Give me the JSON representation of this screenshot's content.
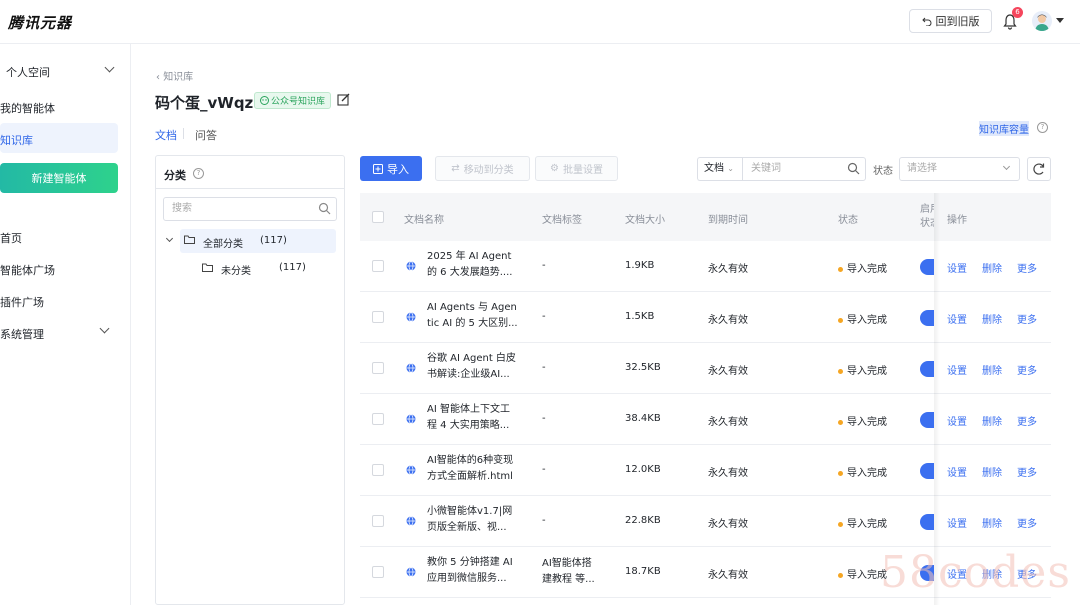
{
  "topbar": {
    "logo": "腾讯元器",
    "back_old_label": "回到旧版",
    "notification_count": "6"
  },
  "sidebar": {
    "personal_space": "个人空间",
    "my_agents": "我的智能体",
    "knowledge_base": "知识库",
    "new_agent": "新建智能体",
    "home": "首页",
    "agent_plaza": "智能体广场",
    "plugin_plaza": "插件广场",
    "system_admin": "系统管理"
  },
  "header": {
    "breadcrumb": "知识库",
    "title": "码个蛋_vWqz",
    "tag": "公众号知识库",
    "tabs": [
      "文档",
      "问答"
    ],
    "capacity": "知识库容量"
  },
  "category": {
    "title": "分类",
    "search_placeholder": "搜索",
    "all_label": "全部分类",
    "all_count": "(117)",
    "uncat_label": "未分类",
    "uncat_count": "(117)"
  },
  "toolbar": {
    "import": "导入",
    "move": "移动到分类",
    "batch": "批量设置",
    "type_value": "文档",
    "keyword_placeholder": "关键词",
    "status_label": "状态",
    "status_placeholder": "请选择"
  },
  "table": {
    "headers": [
      "文档名称",
      "文档标签",
      "文档大小",
      "到期时间",
      "状态",
      "启用\n状态",
      "操作"
    ],
    "header_enable_line1": "启用",
    "header_enable_line2": "状态",
    "rows": [
      {
        "name1": "2025 年 AI Agent",
        "name2": "的 6 大发展趋势....",
        "tag1": "-",
        "tag2": "",
        "size": "1.9KB",
        "expire": "永久有效",
        "status": "导入完成"
      },
      {
        "name1": "AI Agents 与 Agen",
        "name2": "tic AI 的 5 大区别...",
        "tag1": "-",
        "tag2": "",
        "size": "1.5KB",
        "expire": "永久有效",
        "status": "导入完成"
      },
      {
        "name1": "谷歌 AI Agent 白皮",
        "name2": "书解读:企业级AI...",
        "tag1": "-",
        "tag2": "",
        "size": "32.5KB",
        "expire": "永久有效",
        "status": "导入完成"
      },
      {
        "name1": "AI 智能体上下文工",
        "name2": "程 4 大实用策略...",
        "tag1": "-",
        "tag2": "",
        "size": "38.4KB",
        "expire": "永久有效",
        "status": "导入完成"
      },
      {
        "name1": "AI智能体的6种变现",
        "name2": "方式全面解析.html",
        "tag1": "-",
        "tag2": "",
        "size": "12.0KB",
        "expire": "永久有效",
        "status": "导入完成"
      },
      {
        "name1": "小微智能体v1.7|网",
        "name2": "页版全新版、视...",
        "tag1": "-",
        "tag2": "",
        "size": "22.8KB",
        "expire": "永久有效",
        "status": "导入完成"
      },
      {
        "name1": "教你 5 分钟搭建 AI",
        "name2": "应用到微信服务...",
        "tag1": "AI智能体搭",
        "tag2": "建教程 等...",
        "size": "18.7KB",
        "expire": "永久有效",
        "status": "导入完成"
      }
    ],
    "ops": [
      "设置",
      "删除",
      "更多"
    ]
  },
  "watermark": "58codes"
}
